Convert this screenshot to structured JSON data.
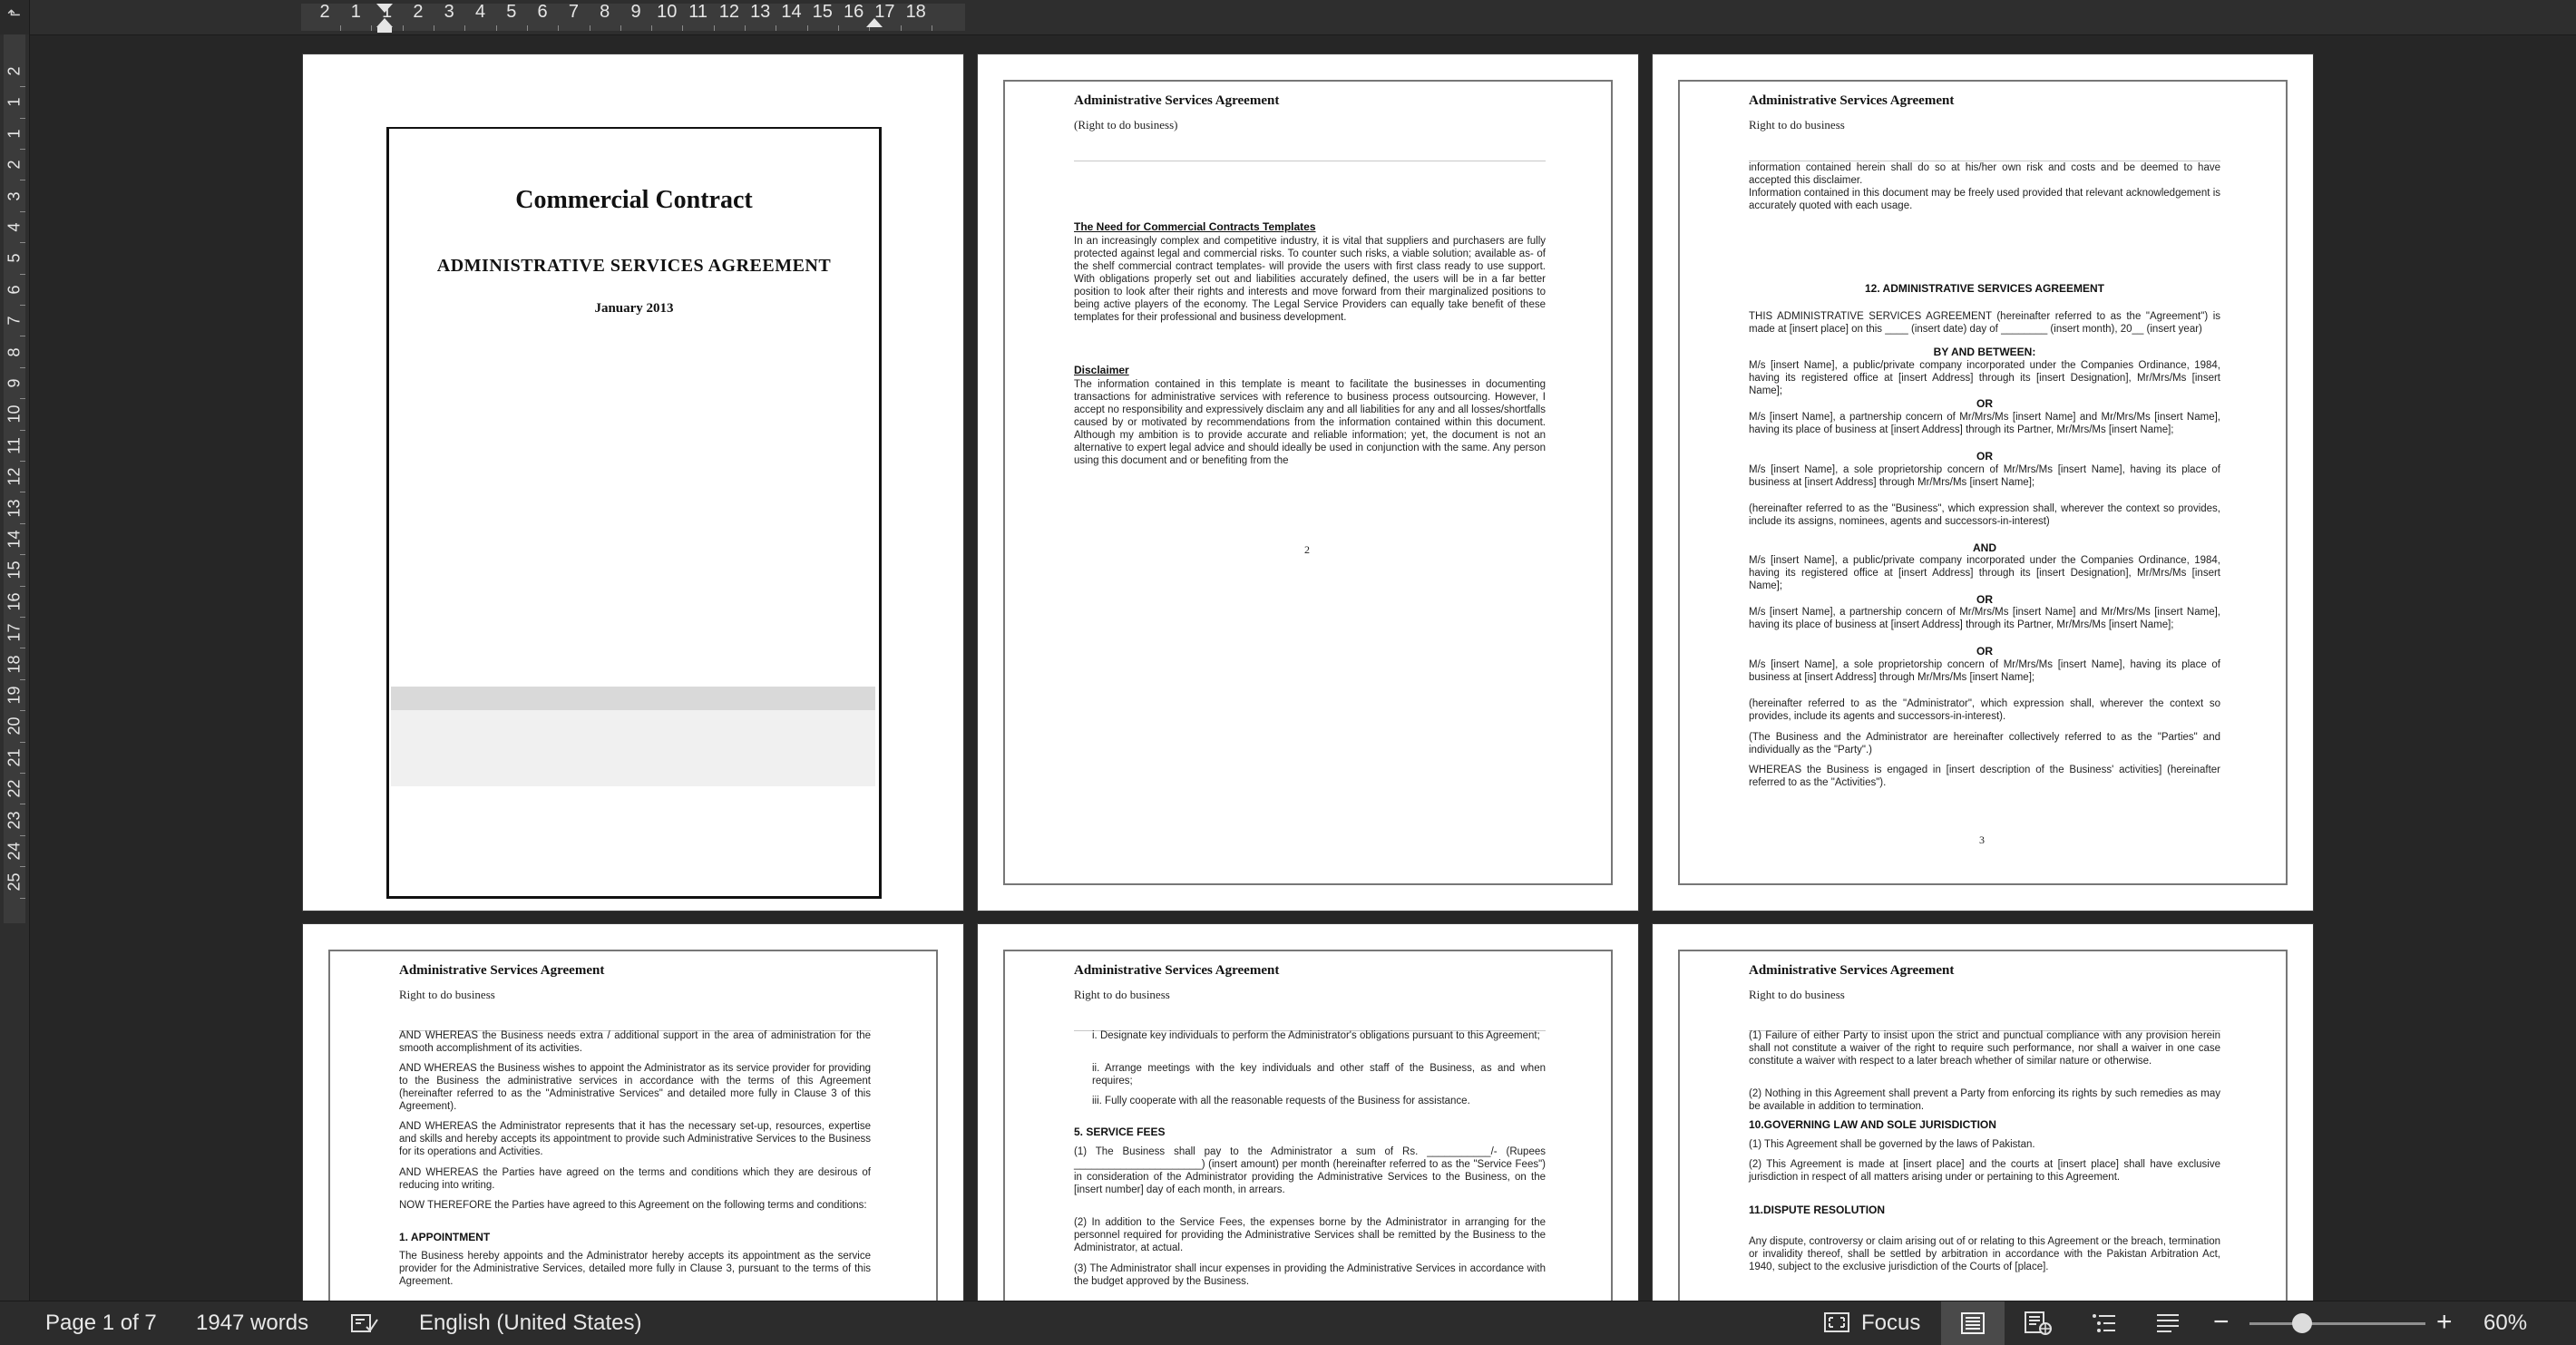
{
  "ruler": {
    "menu_glyph": "⬑",
    "h_numbers": [
      "2",
      "1",
      "1",
      "2",
      "3",
      "4",
      "5",
      "6",
      "7",
      "8",
      "9",
      "10",
      "11",
      "12",
      "13",
      "14",
      "15",
      "16",
      "17",
      "18"
    ],
    "v_numbers": [
      "2",
      "1",
      "1",
      "2",
      "3",
      "4",
      "5",
      "6",
      "7",
      "8",
      "9",
      "10",
      "11",
      "12",
      "13",
      "14",
      "15",
      "16",
      "17",
      "18",
      "19",
      "20",
      "21",
      "22",
      "23",
      "24",
      "25"
    ]
  },
  "pages": {
    "p1": {
      "title": "Commercial Contract",
      "subtitle": "ADMINISTRATIVE SERVICES AGREEMENT",
      "date": "January 2013"
    },
    "p2": {
      "header_title": "Administrative Services Agreement",
      "header_sub": "(Right to do business)",
      "heading1": "The Need for Commercial Contracts Templates",
      "para1": "In an increasingly complex and competitive industry, it is vital that suppliers and purchasers are fully protected against legal and commercial risks.  To counter such risks, a viable solution; available as- of the shelf commercial contract templates- will provide the users with first class ready to use support. With obligations properly set out and liabilities accurately defined, the users will be in a far better position to look after their rights and interests and move forward from their marginalized positions to being active players of the economy. The Legal Service Providers can equally take benefit of these templates for their professional and business development.",
      "heading2": "Disclaimer",
      "para2": "The information contained in this template is meant to facilitate the businesses in documenting transactions for administrative services with reference to business process outsourcing. However, I accept no responsibility and expressively disclaim any and all liabilities for any and all losses/shortfalls caused by or motivated by recommendations from the information contained within this document. Although my ambition is to provide accurate and reliable information; yet, the document is not an alternative to expert legal advice and should ideally be used in conjunction with the same. Any person using this document and or benefiting from the",
      "page_number": "2"
    },
    "p3": {
      "header_title": "Administrative Services Agreement",
      "header_sub": "Right to do business",
      "top_para": "information contained herein shall do so at his/her own risk and costs and be deemed to have accepted this disclaimer.\nInformation contained in this document may be freely used provided that relevant acknowledgement is accurately quoted with each usage.",
      "section_title": "12. ADMINISTRATIVE SERVICES AGREEMENT",
      "intro": "THIS ADMINISTRATIVE SERVICES AGREEMENT (hereinafter referred to as the \"Agreement\") is made at [insert place] on this ____ (insert date) day of ________ (insert month), 20__ (insert year)",
      "by_and_between": "BY AND BETWEEN:",
      "party1a": "M/s [insert Name], a public/private company incorporated under the Companies Ordinance, 1984, having its registered office at [insert Address] through its [insert Designation], Mr/Mrs/Ms [insert Name];",
      "or1": "OR",
      "party1b": "M/s [insert Name], a partnership concern of Mr/Mrs/Ms [insert Name] and Mr/Mrs/Ms [insert Name], having its place of business at [insert Address] through its Partner, Mr/Mrs/Ms [insert Name];",
      "or2": "OR",
      "party1c": "M/s [insert Name], a sole proprietorship concern of Mr/Mrs/Ms [insert Name], having its place of business at [insert Address] through Mr/Mrs/Ms [insert Name];",
      "business_def": "(hereinafter referred to as the \"Business\", which expression shall, wherever the context so provides, include its assigns, nominees, agents and successors-in-interest)",
      "and": "AND",
      "party2a": "M/s [insert Name], a public/private company incorporated under the Companies Ordinance, 1984, having its registered office at [insert Address] through its [insert Designation], Mr/Mrs/Ms [insert Name];",
      "or3": "OR",
      "party2b": "M/s [insert Name], a partnership concern of Mr/Mrs/Ms [insert Name] and Mr/Mrs/Ms [insert Name], having its place of business at [insert Address] through its Partner, Mr/Mrs/Ms [insert Name];",
      "or4": "OR",
      "party2c": "M/s [insert Name], a sole proprietorship concern of Mr/Mrs/Ms [insert Name], having its place of business at [insert Address] through Mr/Mrs/Ms [insert Name];",
      "admin_def": "(hereinafter referred to as the \"Administrator\", which expression shall, wherever the context so provides, include its agents and successors-in-interest).",
      "parties_def": "(The Business and the Administrator are hereinafter collectively referred to as the \"Parties\" and individually as the \"Party\".)",
      "whereas": "WHEREAS the Business is engaged in [insert description of the Business' activities] (hereinafter referred to as the \"Activities\").",
      "page_number": "3"
    },
    "p4": {
      "header_title": "Administrative Services Agreement",
      "header_sub": "Right to do business",
      "w1": "AND WHEREAS the Business needs extra / additional support in the area of administration for the smooth accomplishment of its activities.",
      "w2": "AND WHEREAS the Business wishes to appoint the Administrator as its service provider for providing to the Business the administrative services in accordance with the terms of this Agreement (hereinafter referred to as the \"Administrative Services\" and detailed more fully in Clause 3 of this Agreement).",
      "w3": "AND WHEREAS the Administrator represents that it has the necessary set-up, resources, expertise and skills and hereby accepts its appointment to provide such Administrative Services to the Business for its operations and Activities.",
      "w4": "AND WHEREAS the Parties have agreed on the terms and conditions which they are desirous of reducing into writing.",
      "now": "NOW THEREFORE the Parties have agreed to this Agreement on the following terms and conditions:",
      "appointment_title": "1.  APPOINTMENT",
      "appointment": "The Business hereby appoints and the Administrator hereby accepts its appointment as the service provider for the Administrative Services, detailed more fully in Clause 3, pursuant to the terms of this Agreement."
    },
    "p5": {
      "header_title": "Administrative Services Agreement",
      "header_sub": "Right to do business",
      "i": "i.   Designate key individuals to perform the Administrator's obligations pursuant to this Agreement;",
      "ii": "ii.  Arrange meetings with the key individuals and other staff of the Business, as and when requires;",
      "iii": "iii. Fully cooperate with all the reasonable requests of the Business for assistance.",
      "fees_title": "5.  SERVICE FEES",
      "f1": "(1) The Business shall pay to the Administrator a sum of Rs. ___________/- (Rupees ______________________) (insert amount) per month (hereinafter referred to as the \"Service Fees\") in consideration of the Administrator providing the Administrative Services to the Business, on the [insert number] day of each month, in arrears.",
      "f2": "(2) In addition to the Service Fees, the expenses borne by the Administrator in arranging for the personnel required for providing the Administrative Services shall be remitted by the Business to the Administrator, at actual.",
      "f3": "(3) The Administrator shall incur expenses in providing the Administrative Services in accordance with the budget approved by the Business."
    },
    "p6": {
      "header_title": "Administrative Services Agreement",
      "header_sub": "Right to do business",
      "c1": "(1) Failure of either Party to insist upon the strict and punctual compliance with any provision herein shall not constitute a waiver of the right to require such performance, nor shall a waiver in one case constitute a waiver with respect to a later breach whether of similar nature or otherwise.",
      "c2": "(2) Nothing in this Agreement shall prevent a Party from enforcing its rights by such remedies as may be available in addition to termination.",
      "gov_title": "10.GOVERNING LAW AND SOLE JURISDICTION",
      "g1": "(1) This Agreement shall be governed by the laws of Pakistan.",
      "g2": "(2) This Agreement is made at [insert place] and the courts at [insert place] shall have exclusive jurisdiction in respect of all matters arising under or pertaining to this Agreement.",
      "dispute_title": "11.DISPUTE  RESOLUTION",
      "dispute": "Any dispute, controversy or claim arising out of or relating to this Agreement or the breach, termination or invalidity thereof, shall be settled by arbitration in accordance with the Pakistan Arbitration Act, 1940, subject to the exclusive jurisdiction of the Courts of [place]."
    }
  },
  "status_bar": {
    "page_info": "Page 1 of 7",
    "word_count": "1947 words",
    "language": "English (United States)",
    "focus_label": "Focus",
    "zoom_minus": "−",
    "zoom_plus": "+",
    "zoom_level": "60%",
    "zoom_fraction": 0.3
  }
}
